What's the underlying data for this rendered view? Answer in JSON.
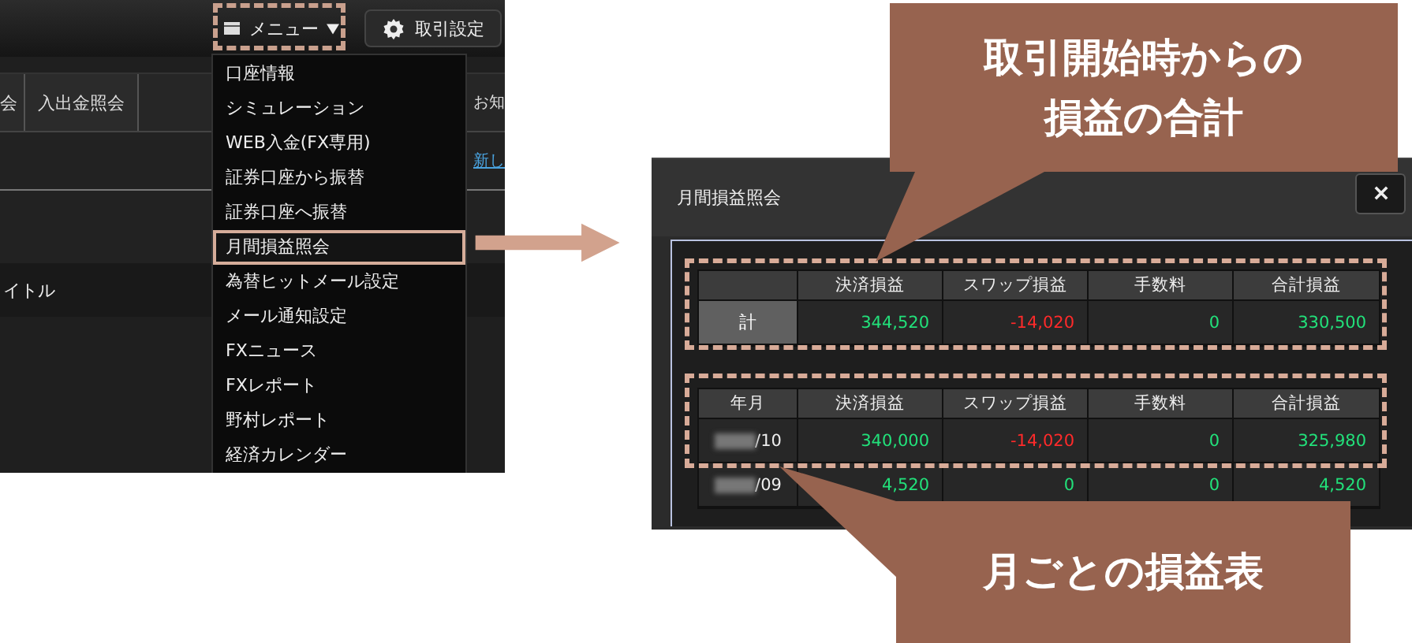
{
  "menu_screenshot": {
    "menu_button": "メニュー",
    "settings_button": "取引設定",
    "tabs": [
      "会",
      "入出金照会"
    ],
    "notice_label": "お知",
    "news_link": "新し",
    "title_label": "イトル",
    "menu_items": [
      {
        "label": "口座情報",
        "selected": false
      },
      {
        "label": "シミュレーション",
        "selected": false
      },
      {
        "label": "WEB入金(FX専用)",
        "selected": false
      },
      {
        "label": "証券口座から振替",
        "selected": false
      },
      {
        "label": "証券口座へ振替",
        "selected": false
      },
      {
        "label": "月間損益照会",
        "selected": true
      },
      {
        "label": "為替ヒットメール設定",
        "selected": false
      },
      {
        "label": "メール通知設定",
        "selected": false
      },
      {
        "label": "FXニュース",
        "selected": false
      },
      {
        "label": "FXレポート",
        "selected": false
      },
      {
        "label": "野村レポート",
        "selected": false
      },
      {
        "label": "経済カレンダー",
        "selected": false
      }
    ]
  },
  "dialog": {
    "title": "月間損益照会",
    "summary_table": {
      "columns": [
        "",
        "決済損益",
        "スワップ損益",
        "手数料",
        "合計損益"
      ],
      "rows": [
        {
          "cells": [
            {
              "text": "計",
              "kind": "label"
            },
            {
              "text": "344,520",
              "color": "#22e07a"
            },
            {
              "text": "-14,020",
              "color": "#ff2a2a"
            },
            {
              "text": "0",
              "color": "#22e07a"
            },
            {
              "text": "330,500",
              "color": "#22e07a"
            }
          ]
        }
      ]
    },
    "monthly_table": {
      "columns": [
        "年月",
        "決済損益",
        "スワップ損益",
        "手数料",
        "合計損益"
      ],
      "rows": [
        {
          "cells": [
            {
              "text": "/10",
              "kind": "month"
            },
            {
              "text": "340,000",
              "color": "#22e07a"
            },
            {
              "text": "-14,020",
              "color": "#ff2a2a"
            },
            {
              "text": "0",
              "color": "#22e07a"
            },
            {
              "text": "325,980",
              "color": "#22e07a"
            }
          ]
        },
        {
          "cells": [
            {
              "text": "/09",
              "kind": "month"
            },
            {
              "text": "4,520",
              "color": "#22e07a"
            },
            {
              "text": "0",
              "color": "#22e07a"
            },
            {
              "text": "0",
              "color": "#22e07a"
            },
            {
              "text": "4,520",
              "color": "#22e07a"
            }
          ]
        }
      ]
    }
  },
  "callouts": [
    {
      "lines": [
        "取引開始時からの",
        "損益の合計"
      ],
      "kind": "top"
    },
    {
      "lines": [
        "月ごとの損益表"
      ],
      "kind": "bottom"
    }
  ]
}
